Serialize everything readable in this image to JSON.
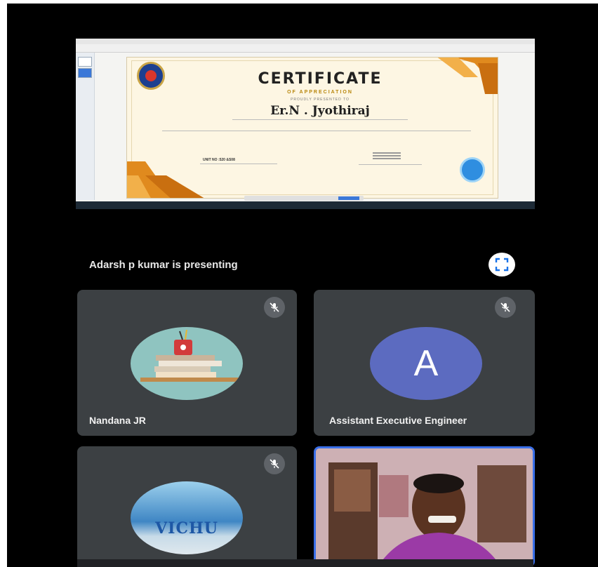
{
  "shared_screen": {
    "certificate": {
      "title": "CERTIFICATE",
      "subtitle": "OF APPRECIATION",
      "presented": "PROUDLY PRESENTED TO",
      "name": "Er.N . Jyothiraj",
      "unit_label": "UNIT NO :520 &S08"
    }
  },
  "meeting": {
    "presenting_text": "Adarsh p kumar is presenting",
    "participants": [
      {
        "name": "Nandana JR",
        "muted": true,
        "avatar": "books-image"
      },
      {
        "name": "Assistant Executive Engineer",
        "muted": true,
        "avatar_letter": "A"
      },
      {
        "name": "",
        "muted": true,
        "avatar_text": "VICHU"
      },
      {
        "name": "",
        "muted": false,
        "video": true
      }
    ]
  },
  "colors": {
    "background": "#000000",
    "tile": "#3c4043",
    "mic_badge": "#5f6368",
    "avatar_a": "#5c6bc0",
    "active_speaker_border": "#3a6fe8",
    "certificate_accent": "#e08a1e"
  }
}
